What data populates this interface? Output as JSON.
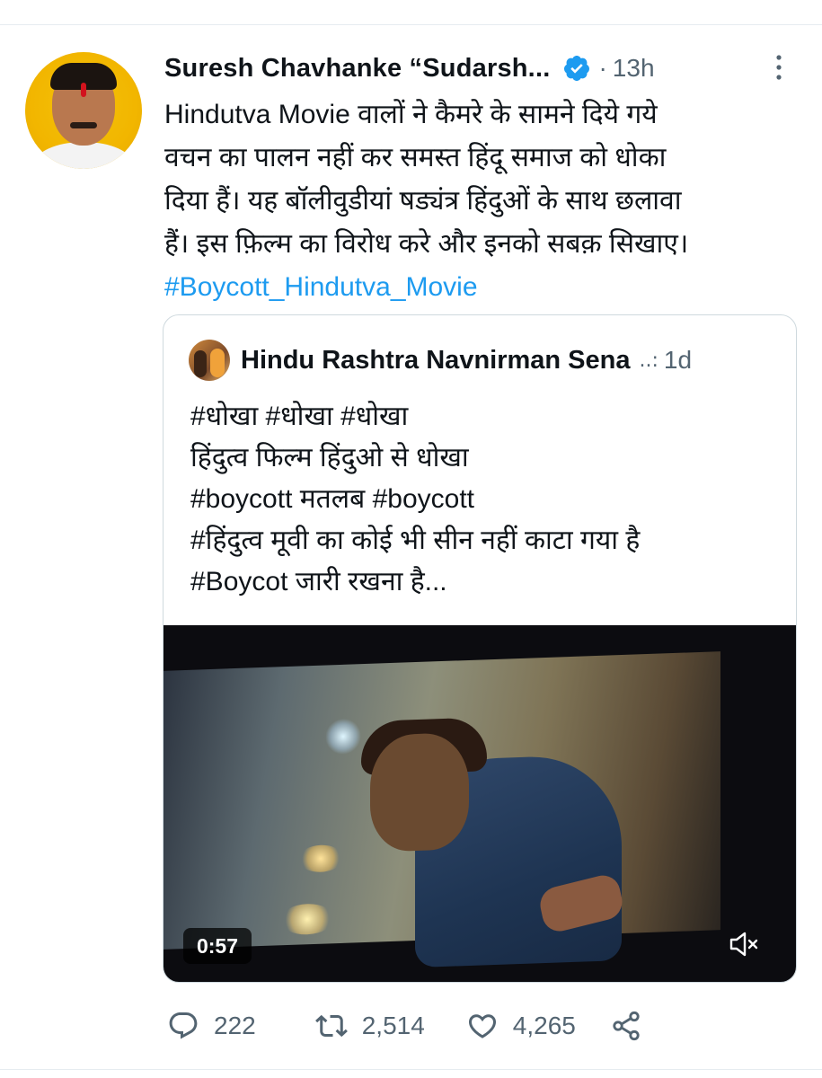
{
  "tweet": {
    "author_name": "Suresh Chavhanke “Sudarsh...",
    "separator": "·",
    "time": "13h",
    "text_lines": [
      "Hindutva Movie वालों ने कैमरे के सामने दिये गये",
      "वचन का पालन नहीं कर समस्त हिंदू समाज को धोका",
      "दिया हैं। यह बॉलीवुडीयां षड्यंत्र हिंदुओं के साथ छलावा",
      "हैं। इस फ़िल्म का विरोध करे और इनको सबक़ सिखाए।"
    ],
    "hashtag": "#Boycott_Hindutva_Movie"
  },
  "quoted": {
    "author_name": "Hindu Rashtra Navnirman Sena",
    "badge": "..:",
    "time": "1d",
    "text_lines": [
      "#धोखा   #धोखा   #धोखा",
      "हिंदुत्व फिल्म हिंदुओ से धोखा",
      "#boycott मतलब #boycott",
      "#हिंदुत्व मूवी का कोई भी सीन नहीं काटा गया है",
      "#Boycot जारी रखना है..."
    ],
    "video": {
      "duration": "0:57",
      "mute_icon": "speaker-muted-icon"
    }
  },
  "actions": {
    "replies": "222",
    "retweets": "2,514",
    "likes": "4,265"
  },
  "colors": {
    "link": "#1d9bf0",
    "secondary_text": "#536471",
    "verified": "#1d9bf0",
    "border": "#cfd9de"
  }
}
